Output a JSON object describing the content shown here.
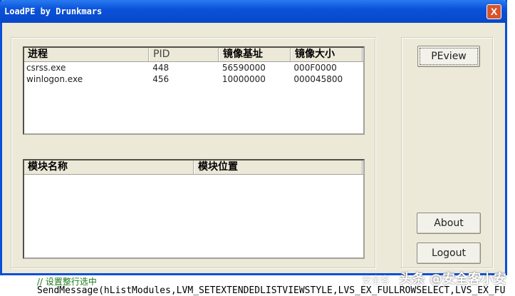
{
  "window": {
    "title": "LoadPE by Drunkmars",
    "close": "X"
  },
  "processes": {
    "columns": [
      "进程",
      "PID",
      "镜像基址",
      "镜像大小"
    ],
    "rows": [
      [
        "csrss.exe",
        "448",
        "56590000",
        "000F0000"
      ],
      [
        "winlogon.exe",
        "456",
        "10000000",
        "000045800"
      ]
    ]
  },
  "modules": {
    "columns": [
      "模块名称",
      "模块位置"
    ]
  },
  "buttons": {
    "peview": "PEview",
    "about": "About",
    "logout": "Logout"
  },
  "background": {
    "comment": "// 设置整行选中",
    "code": "SendMessage(hListModules,LVM_SETEXTENDEDLISTVIEWSTYLE,LVS_EX_FULLROWSELECT,LVS_EX_FU"
  },
  "watermark": {
    "main": "头条 @安全客小安",
    "faint": "安全客"
  }
}
